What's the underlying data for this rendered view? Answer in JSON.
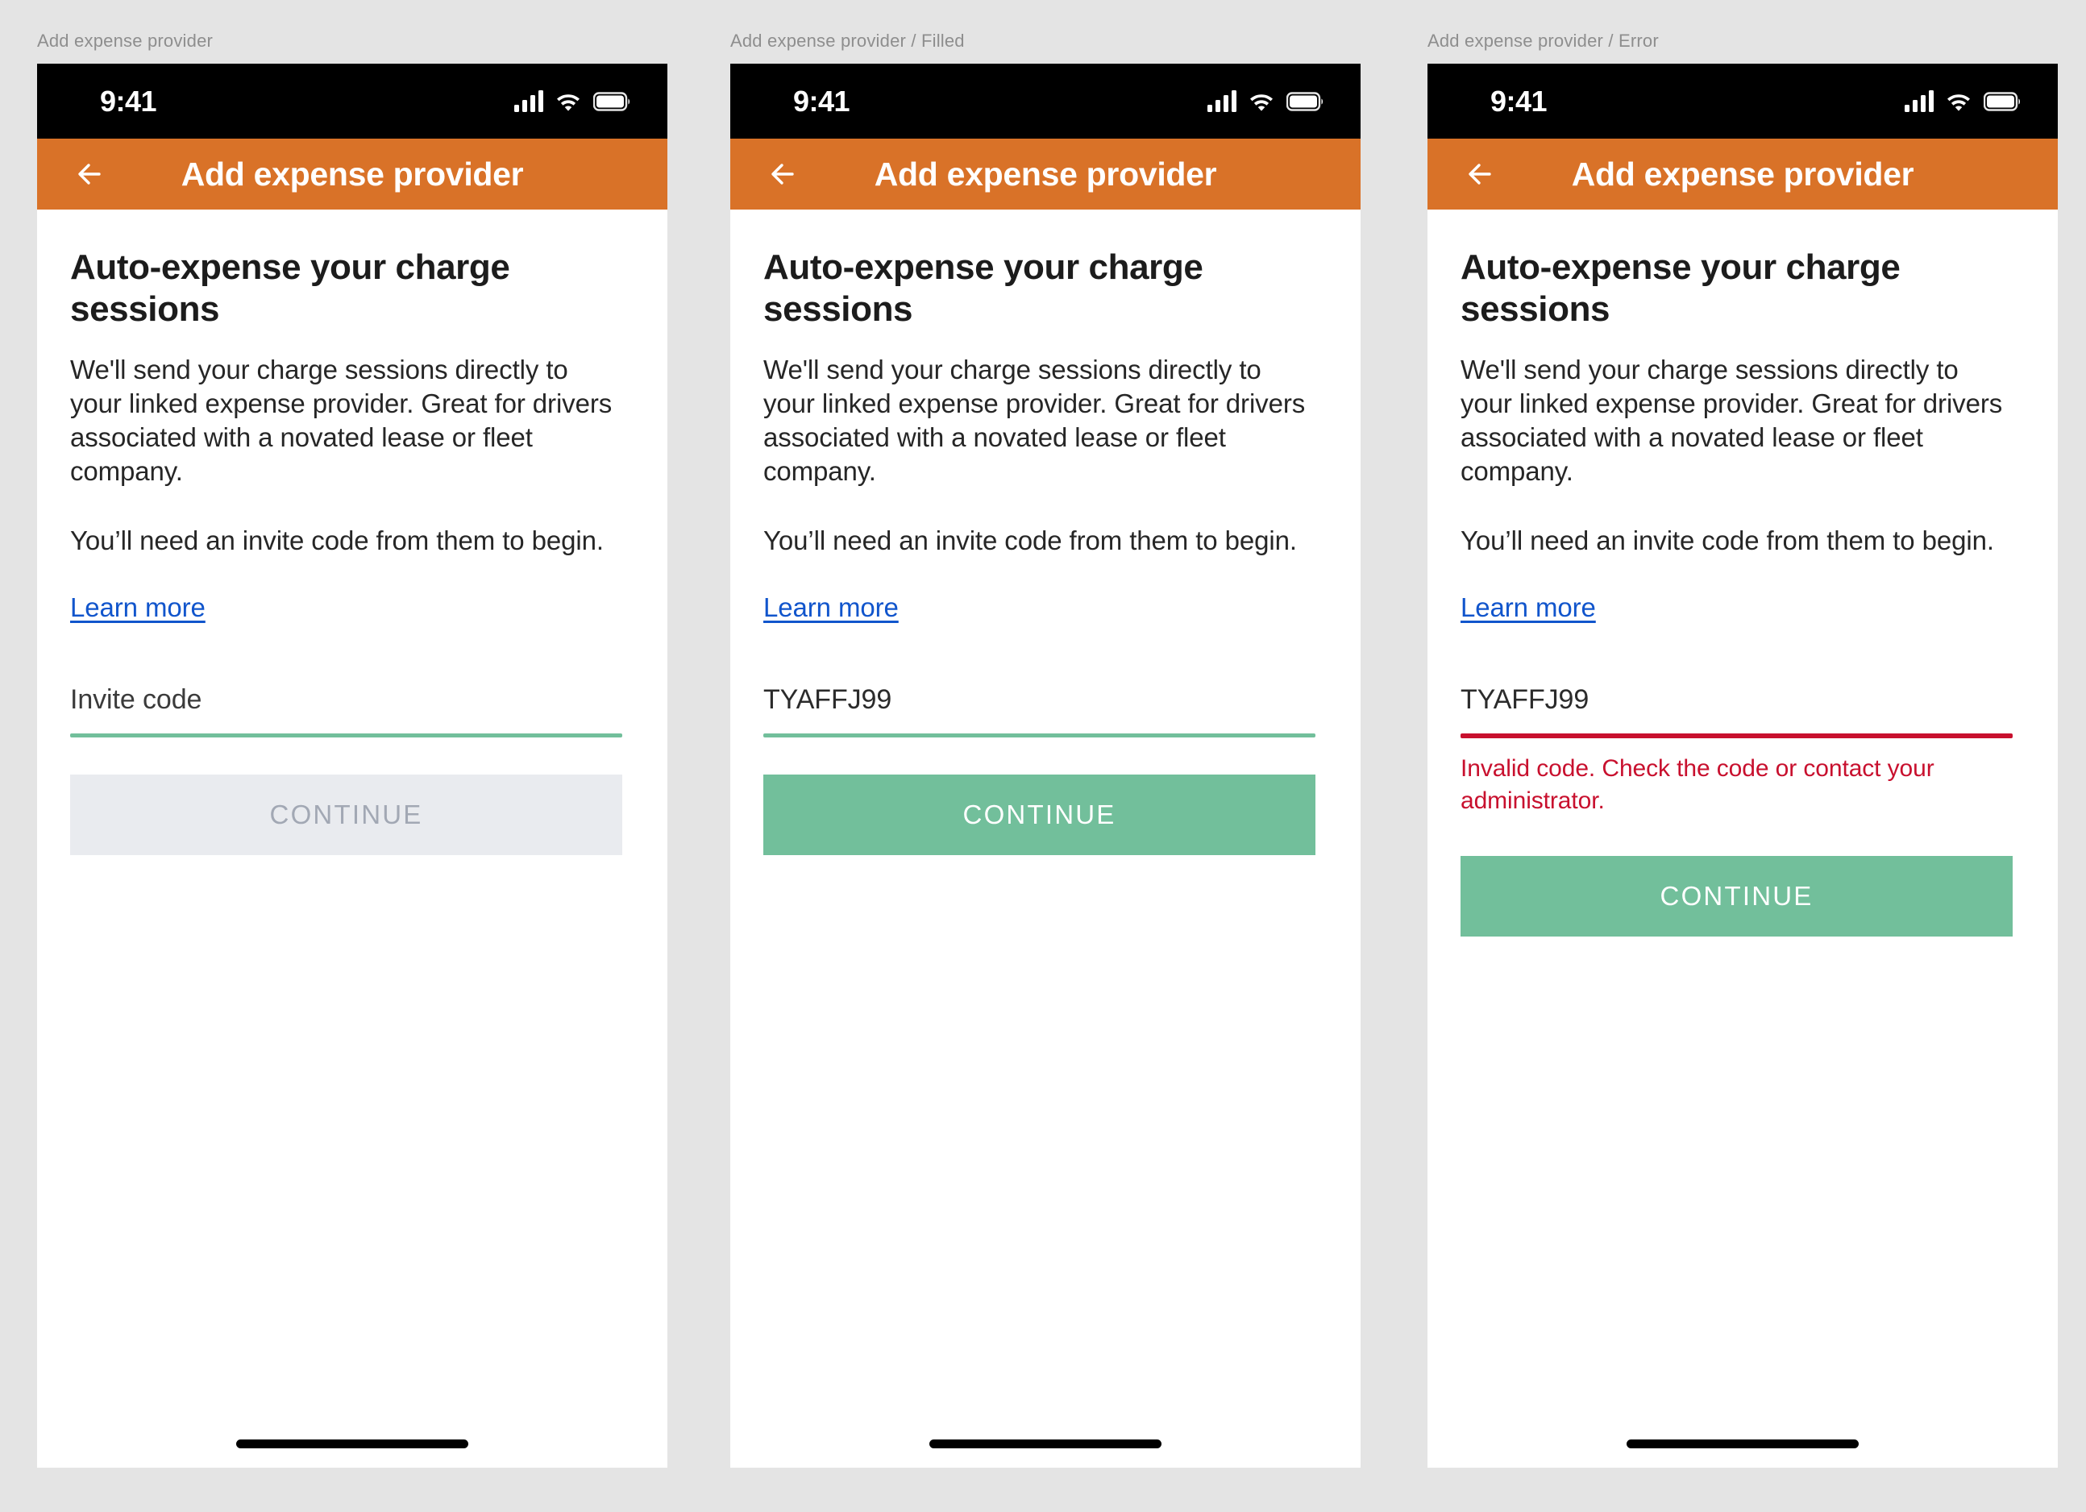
{
  "page": {
    "background_color": "#e4e4e4"
  },
  "theme": {
    "header_orange": "#d97228",
    "accent_green": "#72bf9b",
    "error_red": "#c8102e",
    "link_blue": "#1155cc",
    "disabled_bg": "#e9ebef",
    "disabled_text": "#a2a8b4"
  },
  "frames": [
    {
      "caption": "Add expense provider",
      "status_bar": {
        "time": "9:41",
        "icons": [
          "cellular-signal-icon",
          "wifi-icon",
          "battery-icon"
        ]
      },
      "app_bar": {
        "back_icon": "back-arrow-icon",
        "title": "Add expense provider"
      },
      "content": {
        "headline": "Auto-expense your charge sessions",
        "paragraph_1": "We'll send your charge sessions directly to your linked expense provider. Great for drivers associated with a novated lease or fleet company.",
        "paragraph_2": "You’ll need an invite code from them to begin.",
        "link_label": "Learn more"
      },
      "field": {
        "state": "empty",
        "placeholder": "Invite code",
        "value": "",
        "underline_color": "#72bf9b",
        "error_message": ""
      },
      "cta": {
        "label": "CONTINUE",
        "state": "disabled"
      }
    },
    {
      "caption": "Add expense provider / Filled",
      "status_bar": {
        "time": "9:41",
        "icons": [
          "cellular-signal-icon",
          "wifi-icon",
          "battery-icon"
        ]
      },
      "app_bar": {
        "back_icon": "back-arrow-icon",
        "title": "Add expense provider"
      },
      "content": {
        "headline": "Auto-expense your charge sessions",
        "paragraph_1": "We'll send your charge sessions directly to your linked expense provider. Great for drivers associated with a novated lease or fleet company.",
        "paragraph_2": "You’ll need an invite code from them to begin.",
        "link_label": "Learn more"
      },
      "field": {
        "state": "filled",
        "placeholder": "Invite code",
        "value": "TYAFFJ99",
        "underline_color": "#72bf9b",
        "error_message": ""
      },
      "cta": {
        "label": "CONTINUE",
        "state": "enabled"
      }
    },
    {
      "caption": "Add expense provider / Error",
      "status_bar": {
        "time": "9:41",
        "icons": [
          "cellular-signal-icon",
          "wifi-icon",
          "battery-icon"
        ]
      },
      "app_bar": {
        "back_icon": "back-arrow-icon",
        "title": "Add expense provider"
      },
      "content": {
        "headline": "Auto-expense your charge sessions",
        "paragraph_1": "We'll send your charge sessions directly to your linked expense provider. Great for drivers associated with a novated lease or fleet company.",
        "paragraph_2": "You’ll need an invite code from them to begin.",
        "link_label": "Learn more"
      },
      "field": {
        "state": "error",
        "placeholder": "Invite code",
        "value": "TYAFFJ99",
        "underline_color": "#c8102e",
        "error_message": "Invalid code. Check the code or contact your administrator."
      },
      "cta": {
        "label": "CONTINUE",
        "state": "enabled"
      }
    }
  ]
}
